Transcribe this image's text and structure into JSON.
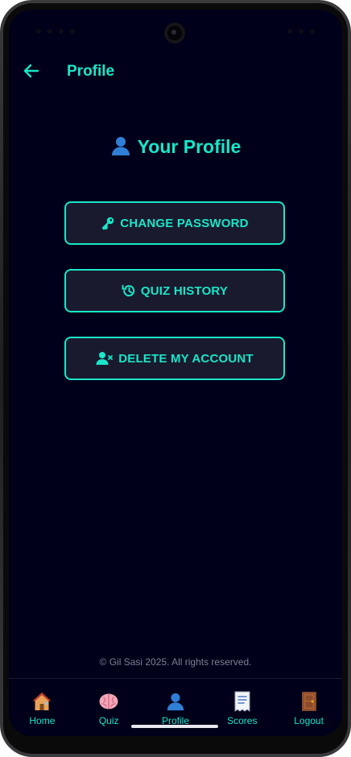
{
  "app_bar": {
    "title": "Profile",
    "back_icon": "arrow-left-icon"
  },
  "heading": {
    "text": "Your Profile",
    "icon": "person-icon"
  },
  "actions": [
    {
      "label": "CHANGE PASSWORD",
      "icon": "key-icon"
    },
    {
      "label": "QUIZ HISTORY",
      "icon": "history-icon"
    },
    {
      "label": "DELETE MY ACCOUNT",
      "icon": "person-remove-icon"
    }
  ],
  "footer": {
    "copyright": "© Gil Sasi 2025. All rights reserved."
  },
  "nav": [
    {
      "label": "Home",
      "icon": "house-icon"
    },
    {
      "label": "Quiz",
      "icon": "brain-icon"
    },
    {
      "label": "Profile",
      "icon": "person-icon",
      "active": true
    },
    {
      "label": "Scores",
      "icon": "receipt-icon"
    },
    {
      "label": "Logout",
      "icon": "door-icon"
    }
  ],
  "colors": {
    "accent": "#19e6c8",
    "background": "#00001a",
    "button_bg": "#1a1a2e",
    "footer_text": "#7a8290"
  }
}
